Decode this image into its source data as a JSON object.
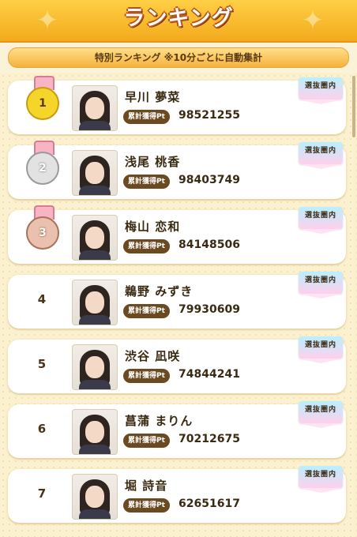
{
  "header": {
    "title": "ランキング"
  },
  "subheader": {
    "text": "特別ランキング ※10分ごとに自動集計"
  },
  "labels": {
    "points_label": "累計獲得Pt",
    "badge": "選抜圏内"
  },
  "entries": [
    {
      "rank": "1",
      "medal": "gold",
      "name": "早川 夢菜",
      "points": "98521255",
      "photo_icon": "member-photo"
    },
    {
      "rank": "2",
      "medal": "silver",
      "name": "浅尾 桃香",
      "points": "98403749",
      "photo_icon": "member-photo"
    },
    {
      "rank": "3",
      "medal": "bronze",
      "name": "梅山 恋和",
      "points": "84148506",
      "photo_icon": "member-photo"
    },
    {
      "rank": "4",
      "medal": "",
      "name": "鵜野 みずき",
      "points": "79930609",
      "photo_icon": "member-photo"
    },
    {
      "rank": "5",
      "medal": "",
      "name": "渋谷 凪咲",
      "points": "74844241",
      "photo_icon": "member-photo"
    },
    {
      "rank": "6",
      "medal": "",
      "name": "菖蒲 まりん",
      "points": "70212675",
      "photo_icon": "member-photo"
    },
    {
      "rank": "7",
      "medal": "",
      "name": "堀 詩音",
      "points": "62651617",
      "photo_icon": "member-photo"
    }
  ],
  "colors": {
    "header": "#f3aa1c",
    "background": "#fbf0cf",
    "points_pill": "#6b4a22"
  }
}
